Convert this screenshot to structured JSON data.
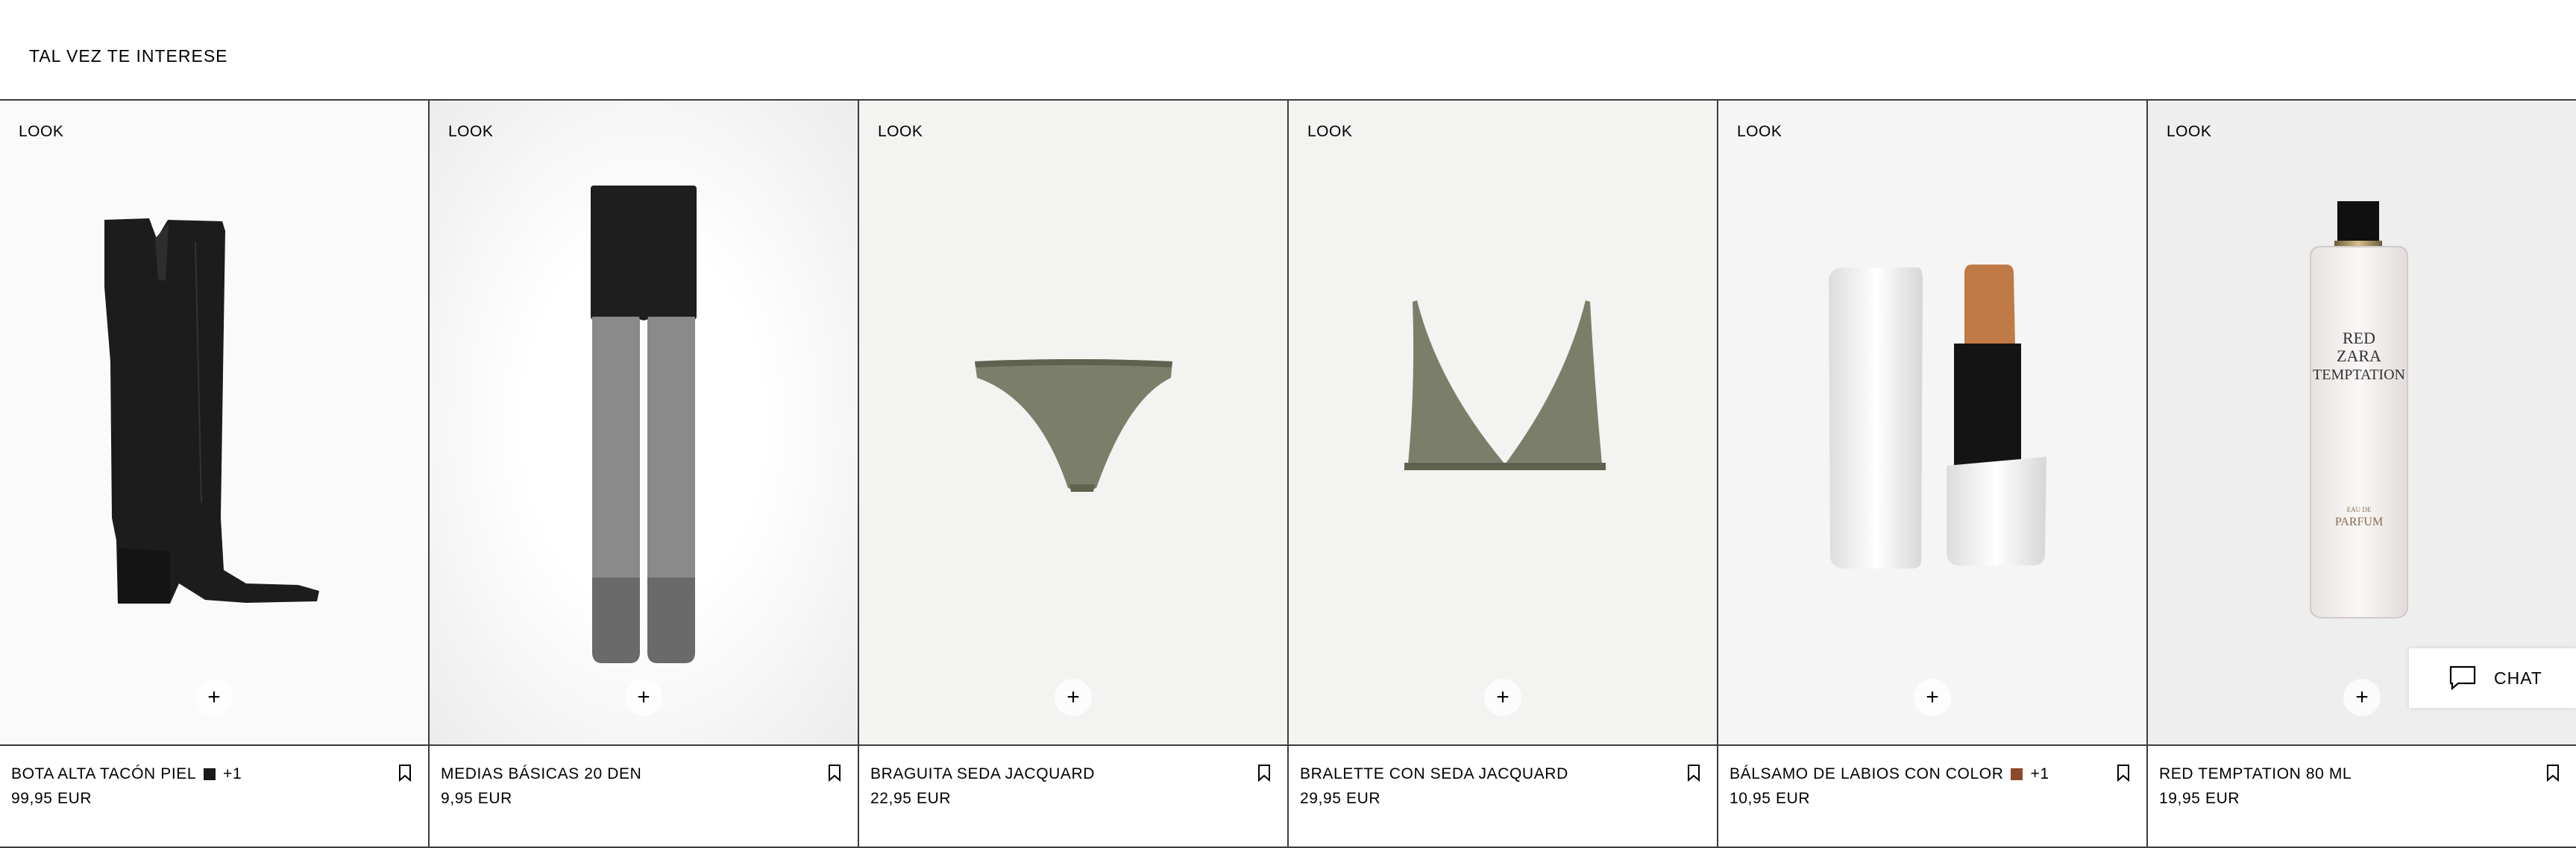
{
  "section": {
    "title": "TAL VEZ TE INTERESE"
  },
  "products": [
    {
      "look": "LOOK",
      "name": "BOTA ALTA TACÓN PIEL",
      "price": "99,95 EUR",
      "more_colors": "+1",
      "swatch": "#1a1a1a",
      "image": "black-knee-high-boot"
    },
    {
      "look": "LOOK",
      "name": "MEDIAS BÁSICAS 20 DEN",
      "price": "9,95 EUR",
      "image": "sheer-tights"
    },
    {
      "look": "LOOK",
      "name": "BRAGUITA SEDA JACQUARD",
      "price": "22,95 EUR",
      "image": "green-silk-brief"
    },
    {
      "look": "LOOK",
      "name": "BRALETTE CON SEDA JACQUARD",
      "price": "29,95 EUR",
      "image": "green-silk-bralette"
    },
    {
      "look": "LOOK",
      "name": "BÁLSAMO DE LABIOS CON COLOR",
      "price": "10,95 EUR",
      "more_colors": "+1",
      "swatch": "#8b4a2b",
      "image": "tinted-lip-balm"
    },
    {
      "look": "LOOK",
      "name": "RED TEMPTATION 80 ML",
      "price": "19,95 EUR",
      "image": "perfume-bottle",
      "bottle_text": {
        "line1": "RED",
        "line2": "ZARA",
        "line3": "TEMPTATION",
        "small": "EAU DE",
        "parfum": "PARFUM"
      }
    }
  ],
  "add_symbol": "+",
  "chat": {
    "label": "CHAT",
    "icon": "chat-bubble-icon"
  }
}
